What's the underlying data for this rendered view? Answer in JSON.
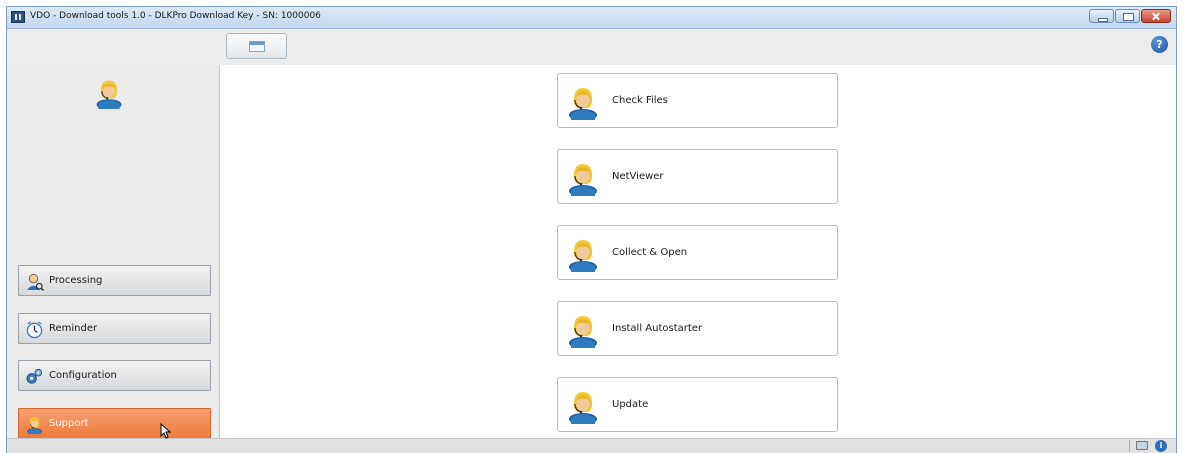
{
  "window": {
    "title": "VDO - Download tools 1.0 - DLKPro Download Key - SN: 1000006"
  },
  "toolbar": {
    "view_button_icon": "window-icon",
    "help_label": "?"
  },
  "sidebar": {
    "items": [
      {
        "label": "Processing",
        "icon": "person-icon",
        "active": false
      },
      {
        "label": "Reminder",
        "icon": "clock-icon",
        "active": false
      },
      {
        "label": "Configuration",
        "icon": "gears-icon",
        "active": false
      },
      {
        "label": "Support",
        "icon": "support-agent-icon",
        "active": true
      }
    ]
  },
  "actions": [
    {
      "label": "Check Files",
      "icon": "support-agent-icon"
    },
    {
      "label": "NetViewer",
      "icon": "support-agent-icon"
    },
    {
      "label": "Collect & Open",
      "icon": "support-agent-icon"
    },
    {
      "label": "Install Autostarter",
      "icon": "support-agent-icon"
    },
    {
      "label": "Update",
      "icon": "support-agent-icon"
    }
  ],
  "statusbar": {
    "info_label": "i"
  },
  "colors": {
    "active_item": "#f08a4b",
    "title_bar": "#c9dbf0",
    "accent_blue": "#2a6fc2"
  }
}
